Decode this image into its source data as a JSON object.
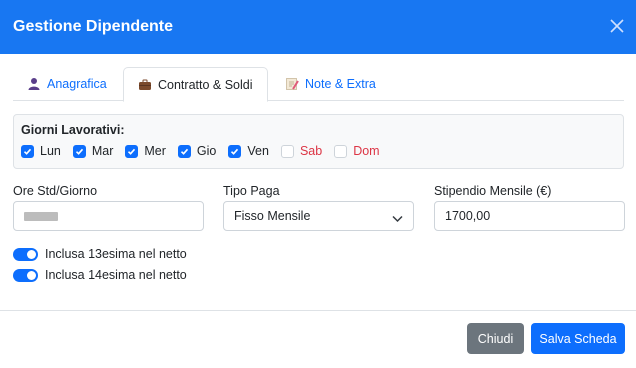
{
  "modal": {
    "title": "Gestione Dipendente"
  },
  "tabs": [
    {
      "label": "Anagrafica",
      "icon": "person-icon",
      "active": false
    },
    {
      "label": "Contratto & Soldi",
      "icon": "briefcase-icon",
      "active": true
    },
    {
      "label": "Note & Extra",
      "icon": "memo-icon",
      "active": false
    }
  ],
  "work_days": {
    "title": "Giorni Lavorativi:",
    "days": [
      {
        "label": "Lun",
        "checked": true
      },
      {
        "label": "Mar",
        "checked": true
      },
      {
        "label": "Mer",
        "checked": true
      },
      {
        "label": "Gio",
        "checked": true
      },
      {
        "label": "Ven",
        "checked": true
      },
      {
        "label": "Sab",
        "checked": false
      },
      {
        "label": "Dom",
        "checked": false
      }
    ]
  },
  "fields": {
    "ore_label": "Ore Std/Giorno",
    "tipo_label": "Tipo Paga",
    "tipo_value": "Fisso Mensile",
    "stipendio_label": "Stipendio Mensile (€)",
    "stipendio_value": "1700,00"
  },
  "switches": [
    {
      "label": "Inclusa 13esima nel netto",
      "on": true
    },
    {
      "label": "Inclusa 14esima nel netto",
      "on": true
    }
  ],
  "footer": {
    "close_label": "Chiudi",
    "save_label": "Salva Scheda"
  },
  "colors": {
    "header": "#1877f2",
    "primary": "#0d6efd",
    "secondary": "#6c757d",
    "weekend": "#dc3545"
  }
}
